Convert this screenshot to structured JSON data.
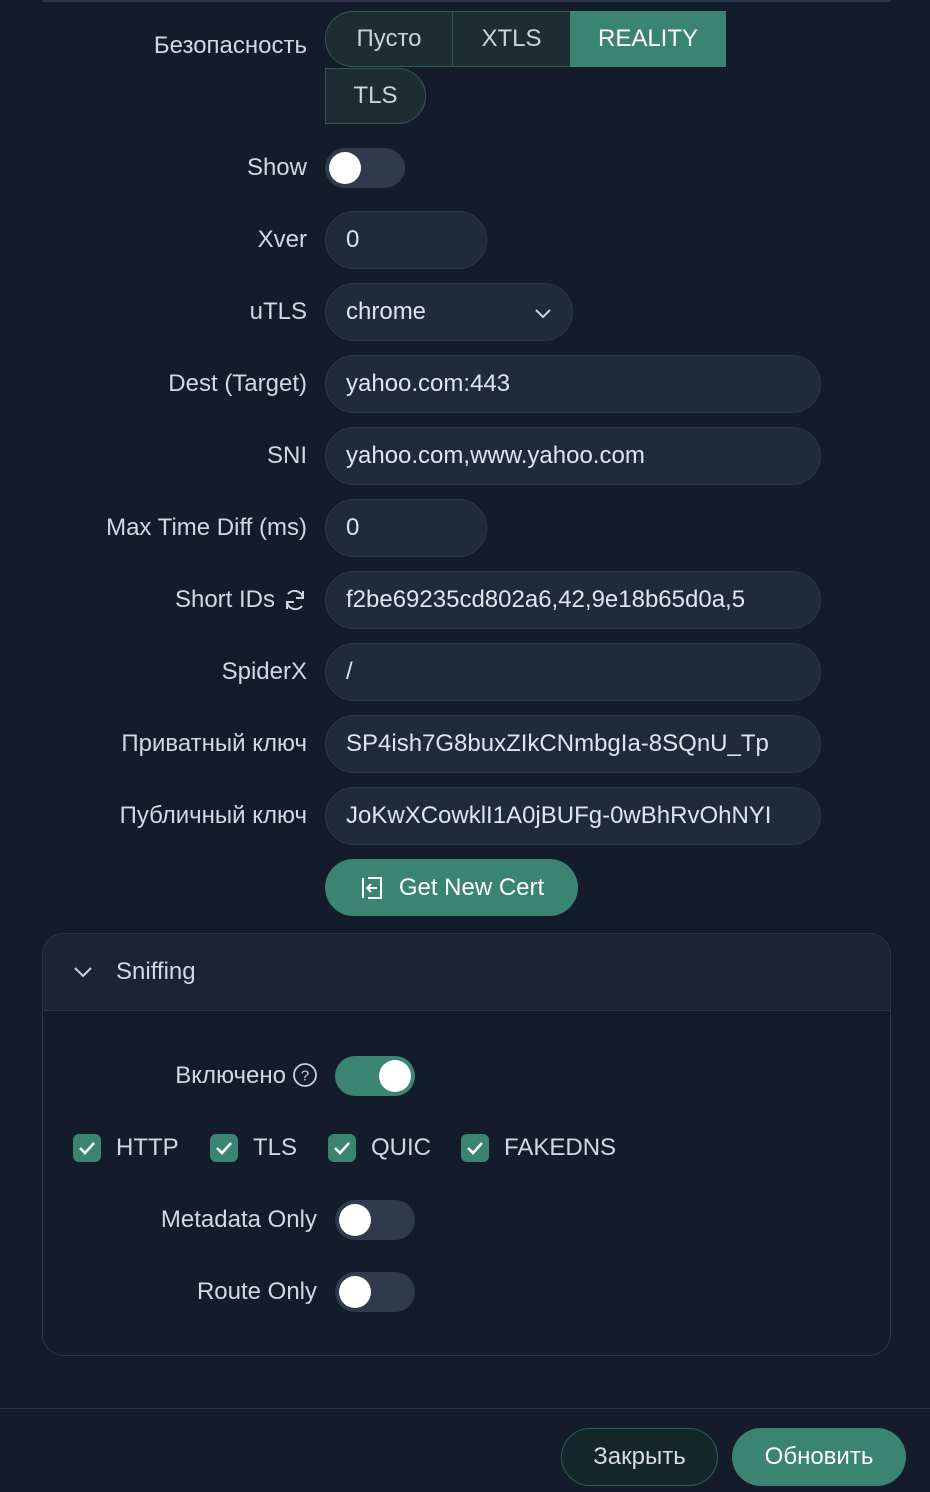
{
  "security": {
    "label": "Безопасность",
    "options": [
      "Пусто",
      "XTLS",
      "REALITY",
      "TLS"
    ],
    "selected": "REALITY"
  },
  "show": {
    "label": "Show",
    "on": false
  },
  "xver": {
    "label": "Xver",
    "value": "0"
  },
  "utls": {
    "label": "uTLS",
    "value": "chrome"
  },
  "dest": {
    "label": "Dest (Target)",
    "value": "yahoo.com:443"
  },
  "sni": {
    "label": "SNI",
    "value": "yahoo.com,www.yahoo.com"
  },
  "max_time_diff": {
    "label": "Max Time Diff (ms)",
    "value": "0"
  },
  "short_ids": {
    "label": "Short IDs",
    "value": "f2be69235cd802a6,42,9e18b65d0a,5"
  },
  "spiderx": {
    "label": "SpiderX",
    "value": "/"
  },
  "private_key": {
    "label": "Приватный ключ",
    "value": "SP4ish7G8buxZIkCNmbgIa-8SQnU_Tp"
  },
  "public_key": {
    "label": "Публичный ключ",
    "value": "JoKwXCowklI1A0jBUFg-0wBhRvOhNYI"
  },
  "get_new_cert": {
    "label": "Get New Cert"
  },
  "sniffing": {
    "title": "Sniffing",
    "enabled_label": "Включено",
    "enabled": true,
    "protocols": [
      {
        "label": "HTTP",
        "checked": true
      },
      {
        "label": "TLS",
        "checked": true
      },
      {
        "label": "QUIC",
        "checked": true
      },
      {
        "label": "FAKEDNS",
        "checked": true
      }
    ],
    "metadata_only": {
      "label": "Metadata Only",
      "on": false
    },
    "route_only": {
      "label": "Route Only",
      "on": false
    }
  },
  "footer": {
    "close_label": "Закрыть",
    "update_label": "Обновить"
  },
  "colors": {
    "accent": "#3a8471",
    "background": "#141c2c",
    "input_bg": "#1f2a3b"
  }
}
